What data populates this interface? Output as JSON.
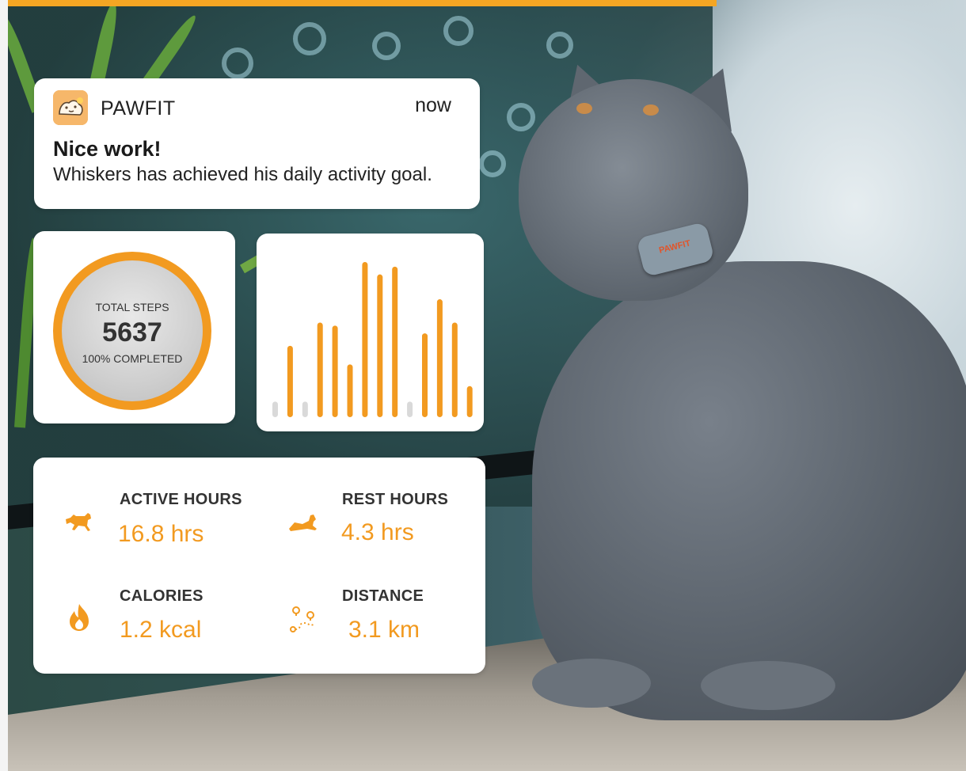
{
  "notification": {
    "app_name": "PAWFIT",
    "time": "now",
    "title": "Nice work!",
    "body": "Whiskers has achieved his daily activity goal."
  },
  "steps": {
    "label": "TOTAL STEPS",
    "value": "5637",
    "completion_text": "100% COMPLETED",
    "progress": 1.0
  },
  "activity_bars": {
    "accent": "#f29a20",
    "inactive": "#d9d9d9",
    "values": [
      0.1,
      0.46,
      0.1,
      0.61,
      0.59,
      0.34,
      1.0,
      0.92,
      0.97,
      0.1,
      0.54,
      0.76,
      0.61,
      0.2
    ],
    "active": [
      false,
      true,
      false,
      true,
      true,
      true,
      true,
      true,
      true,
      false,
      true,
      true,
      true,
      true
    ]
  },
  "stats": {
    "active_hours": {
      "label": "ACTIVE HOURS",
      "value": "16.8 hrs",
      "icon": "running-dog-icon"
    },
    "rest_hours": {
      "label": "REST HOURS",
      "value": "4.3 hrs",
      "icon": "resting-dog-icon"
    },
    "calories": {
      "label": "CALORIES",
      "value": "1.2 kcal",
      "icon": "flame-icon"
    },
    "distance": {
      "label": "DISTANCE",
      "value": "3.1 km",
      "icon": "route-map-icon"
    }
  },
  "collar_brand": "PAWFIT",
  "colors": {
    "accent": "#f29a20",
    "top_bar": "#f5a623"
  }
}
